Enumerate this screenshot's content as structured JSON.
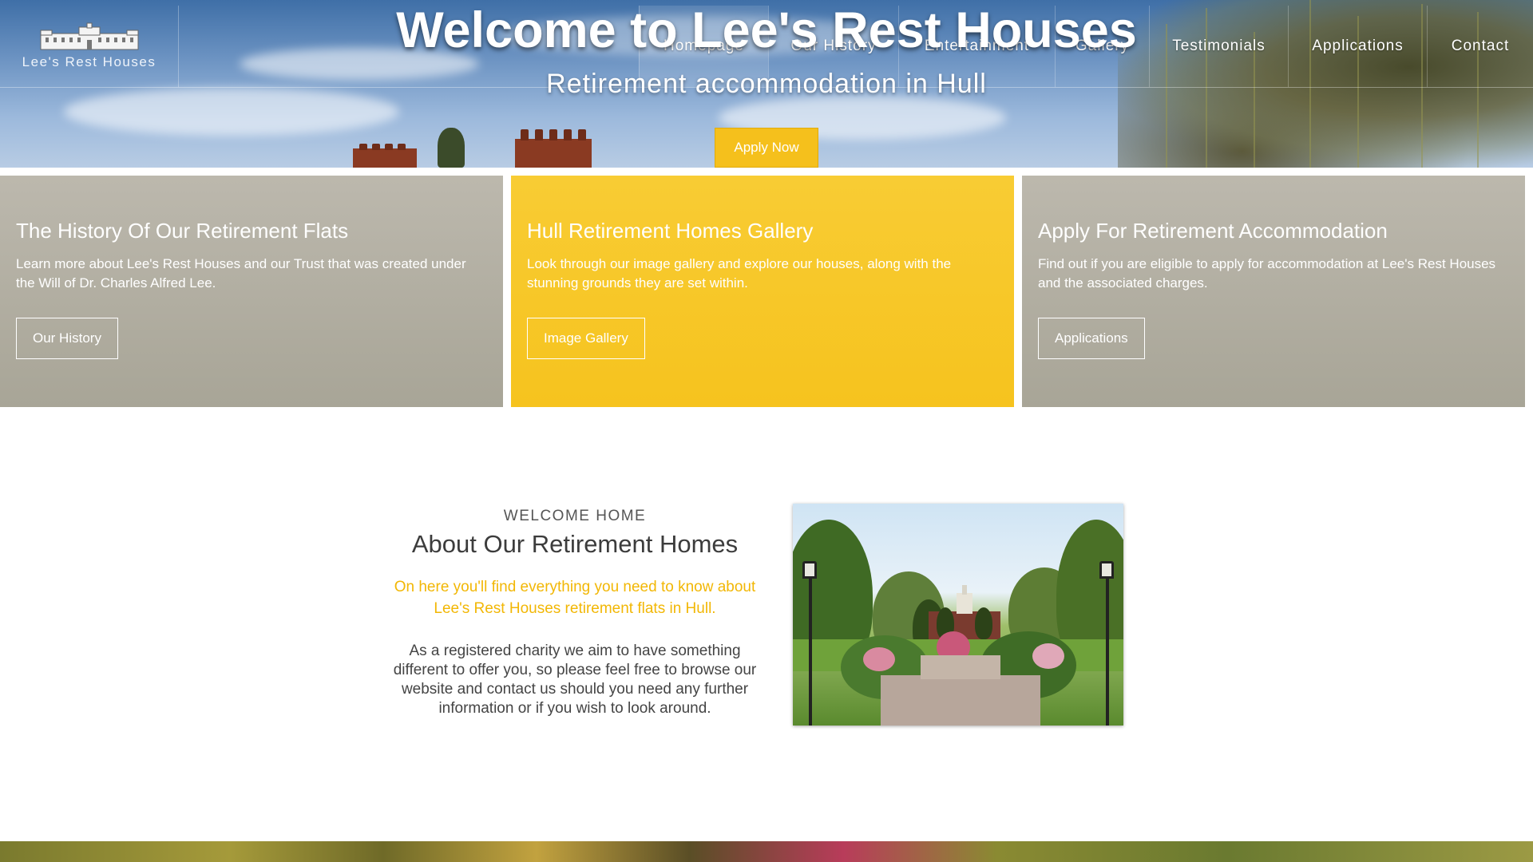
{
  "site": {
    "logo_text": "Lee's Rest Houses"
  },
  "nav": {
    "items": [
      {
        "label": "Homepage"
      },
      {
        "label": "Our History"
      },
      {
        "label": "Entertainment"
      },
      {
        "label": "Gallery"
      },
      {
        "label": "Testimonials"
      },
      {
        "label": "Applications"
      },
      {
        "label": "Contact"
      }
    ],
    "active": "Homepage"
  },
  "hero": {
    "title": "Welcome to Lee's Rest Houses",
    "subtitle": "Retirement accommodation in Hull",
    "cta_label": "Apply Now"
  },
  "panels": [
    {
      "title": "The History Of Our Retirement Flats",
      "text": "Learn more about Lee's Rest Houses and our Trust that was created under the Will of Dr. Charles Alfred Lee.",
      "button": "Our History"
    },
    {
      "title": "Hull Retirement Homes Gallery",
      "text": "Look through our image gallery and explore our houses, along with the stunning grounds they are set within.",
      "button": "Image Gallery"
    },
    {
      "title": "Apply For Retirement Accommodation",
      "text": "Find out if you are eligible to apply for accommodation at Lee's Rest Houses and the associated charges.",
      "button": "Applications"
    }
  ],
  "about": {
    "eyebrow": "WELCOME HOME",
    "title": "About Our Retirement Homes",
    "lead": "On here you'll find everything you need to know about Lee's Rest Houses retirement flats in Hull.",
    "body": "As a registered charity we aim to have something different to offer you, so please feel free to browse our website and contact us should you need any further information or if you wish to look around."
  },
  "colors": {
    "accent_yellow": "#f5c01c",
    "panel_grey": "#b3afa3",
    "lead_text": "#f2b705"
  }
}
